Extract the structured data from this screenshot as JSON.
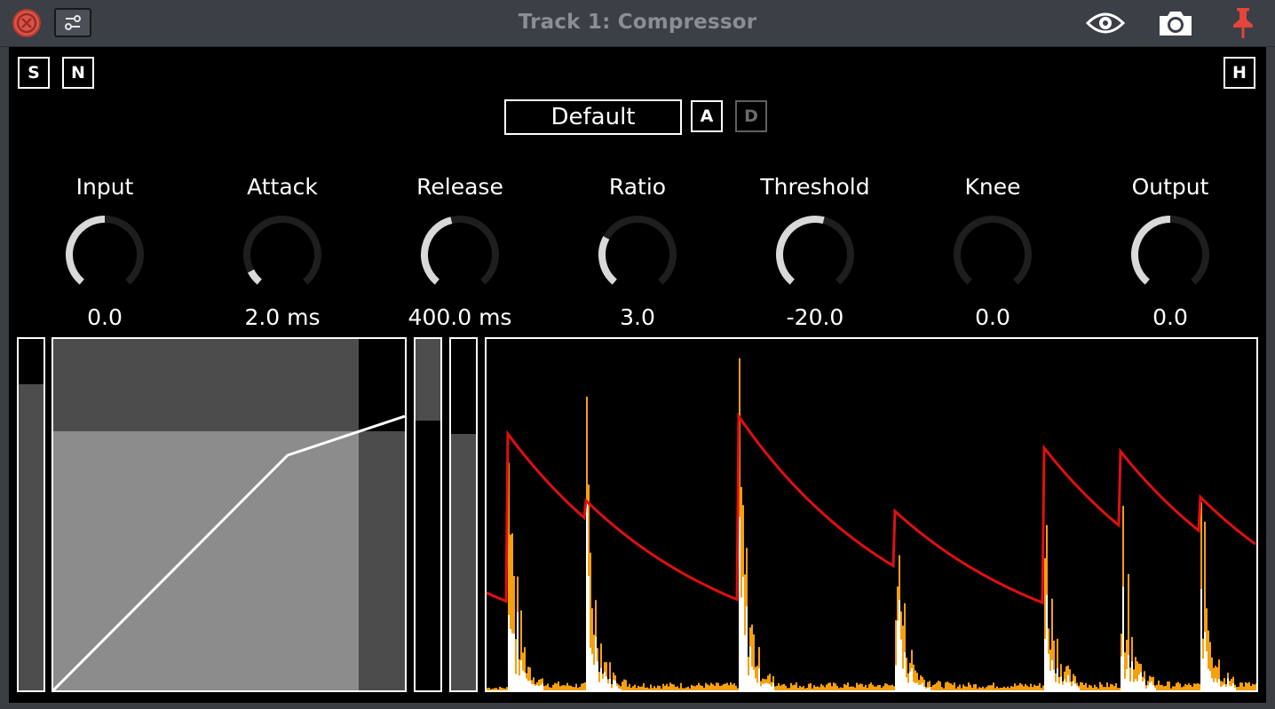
{
  "window": {
    "title": "Track 1: Compressor",
    "icons": [
      "close-icon",
      "settings-sliders-icon",
      "eye-icon",
      "camera-icon",
      "pin-icon"
    ]
  },
  "toolbar": {
    "solo_label": "S",
    "n_label": "N",
    "h_label": "H"
  },
  "preset": {
    "name": "Default",
    "a_label": "A",
    "d_label": "D"
  },
  "knobs": [
    {
      "label": "Input",
      "value": "0.0",
      "level": 0.5
    },
    {
      "label": "Attack",
      "value": "2.0 ms",
      "level": 0.08
    },
    {
      "label": "Release",
      "value": "400.0 ms",
      "level": 0.45
    },
    {
      "label": "Ratio",
      "value": "3.0",
      "level": 0.28
    },
    {
      "label": "Threshold",
      "value": "-20.0",
      "level": 0.55
    },
    {
      "label": "Knee",
      "value": "0.0",
      "level": 0.0
    },
    {
      "label": "Output",
      "value": "0.0",
      "level": 0.5
    }
  ],
  "meters": {
    "input_level": 0.87,
    "gain_reduction_level": 0.76,
    "output_level": 0.73
  },
  "colors": {
    "envelope": "#e01010",
    "signal": "#f5a00f",
    "knob_active": "#d9d9d9",
    "knob_track": "#1e1e1e",
    "close_button": "#d8554a",
    "pin": "#e4453c"
  }
}
